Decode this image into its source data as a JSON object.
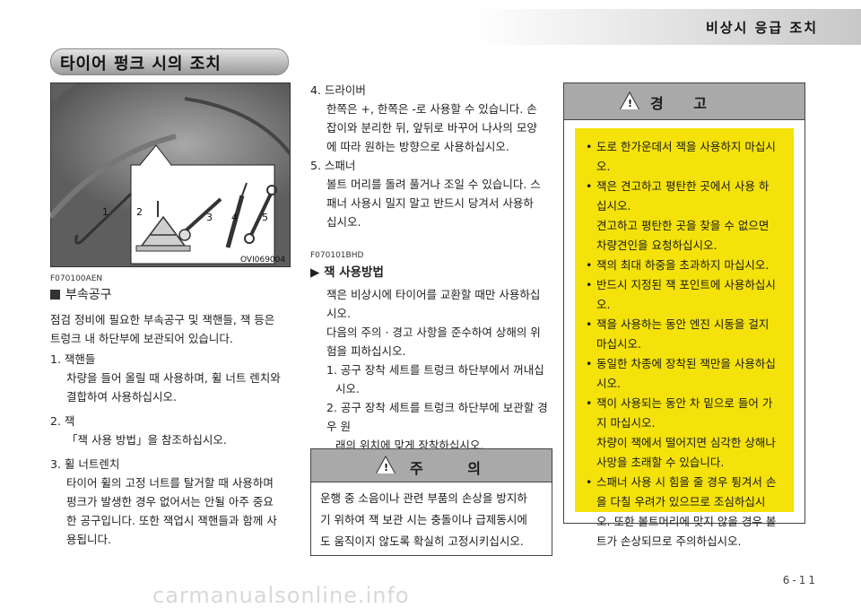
{
  "header": {
    "title": "비상시 응급 조치"
  },
  "section": {
    "title": "타이어 펑크 시의 조치"
  },
  "figure": {
    "code": "OVI069004",
    "labels": [
      "1",
      "2",
      "3",
      "4",
      "5"
    ]
  },
  "left": {
    "code": "F070100AEN",
    "heading": "부속공구",
    "intro": [
      "점검 정비에 필요한 부속공구 및 잭핸들, 잭 등은",
      "트렁크 내 하단부에 보관되어 있습니다."
    ],
    "items": [
      {
        "title": "1. 잭핸들",
        "lines": [
          "차량을 들어 올릴 때 사용하며, 휠 너트 렌치와",
          "결합하여 사용하십시오."
        ]
      },
      {
        "title": "2. 잭",
        "lines": [
          "「잭 사용 방법」을 참조하십시오."
        ]
      },
      {
        "title": "3. 휠 너트렌치",
        "lines": [
          "타이어 휠의 고정 너트를 탈거할 때 사용하며",
          "펑크가 발생한 경우 없어서는 안될 아주 중요",
          "한 공구입니다. 또한 잭업시 잭핸들과 함께 사",
          "용됩니다."
        ]
      }
    ]
  },
  "middle": {
    "items": [
      {
        "title": "4. 드라이버",
        "lines": [
          "한쪽은 +, 한쪽은 -로 사용할 수 있습니다. 손",
          "잡이와 분리한 뒤, 앞뒤로 바꾸어 나사의 모양",
          "에 따라 원하는 방향으로 사용하십시오."
        ]
      },
      {
        "title": "5. 스패너",
        "lines": [
          "볼트 머리를 돌려 풀거나 조일 수 있습니다. 스",
          "패너 사용시 밀지 말고 반드시 당겨서 사용하",
          "십시오."
        ]
      }
    ],
    "code": "F070101BHD",
    "heading": "▶ 잭 사용방법",
    "para1": [
      "잭은 비상시에 타이어를 교환할 때만 사용하십",
      "시오."
    ],
    "para2": [
      "다음의 주의 · 경고 사항을 준수하여 상해의 위",
      "험을 피하십시오."
    ],
    "steps": [
      [
        "1. 공구 장착 세트를 트렁크 하단부에서 꺼내십",
        "시오."
      ],
      [
        "2. 공구 장착 세트를 트렁크 하단부에 보관할 경우 원",
        "래의 위치에 맞게 장착하십시오."
      ]
    ]
  },
  "caution": {
    "title": "주 의",
    "lines": [
      "운행 중 소음이나 관련 부품의 손상을 방지하",
      "기 위하여 잭 보관 시는 충돌이나 급제동시에",
      "도 움직이지 않도록 확실히 고정시키십시오."
    ]
  },
  "warning": {
    "title": "경 고",
    "items": [
      [
        "도로 한가운데서 잭을 사용하지 마십시오."
      ],
      [
        "잭은 견고하고 평탄한 곳에서 사용 하",
        "십시오.",
        "견고하고 평탄한 곳을 찾을 수 없으면",
        "차량견인을 요청하십시오."
      ],
      [
        "잭의 최대 하중을 초과하지 마십시오."
      ],
      [
        "반드시 지정된 잭 포인트에 사용하십시오."
      ],
      [
        "잭을 사용하는 동안 엔진 시동을 걸지",
        "마십시오."
      ],
      [
        "동일한 차종에 장착된 잭만을 사용하십",
        "시오."
      ],
      [
        "잭이 사용되는 동안 차 밑으로 들어 가",
        "지 마십시오.",
        "차량이 잭에서 떨어지면 심각한 상해나",
        "사망을 초래할 수 있습니다."
      ],
      [
        "스패너 사용 시 힘을 줄 경우 튕겨서 손",
        "을 다칠 우려가 있으므로 조심하십시",
        "오. 또한 볼트머리에 맞지 않을 경우 볼",
        "트가 손상되므로 주의하십시오."
      ]
    ]
  },
  "footer": {
    "page": "6-11",
    "watermark": "carmanualsonline.info"
  }
}
